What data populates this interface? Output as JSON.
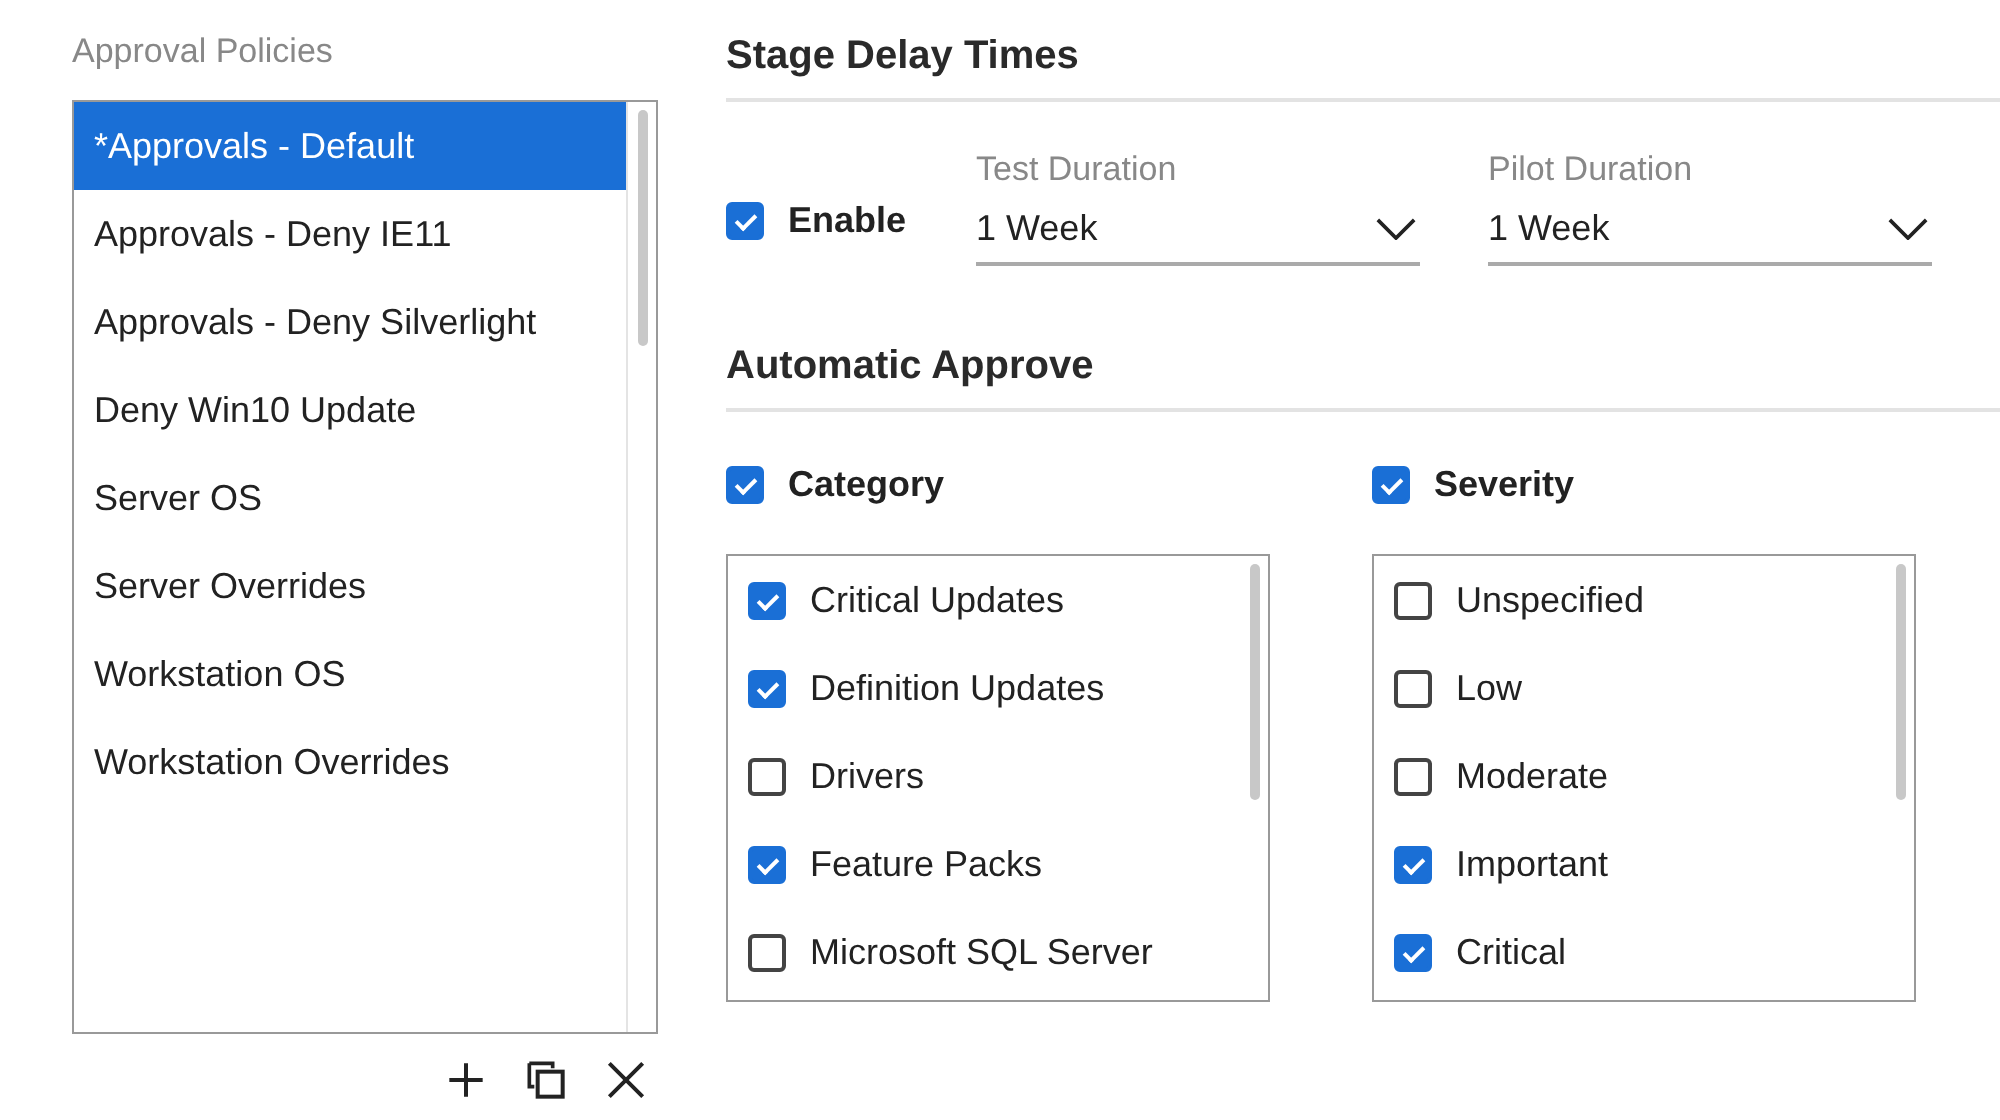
{
  "policies": {
    "title": "Approval Policies",
    "items": [
      {
        "label": "*Approvals - Default",
        "selected": true
      },
      {
        "label": "Approvals - Deny IE11",
        "selected": false
      },
      {
        "label": "Approvals - Deny Silverlight",
        "selected": false
      },
      {
        "label": "Deny Win10 Update",
        "selected": false
      },
      {
        "label": "Server OS",
        "selected": false
      },
      {
        "label": "Server Overrides",
        "selected": false
      },
      {
        "label": "Workstation OS",
        "selected": false
      },
      {
        "label": "Workstation Overrides",
        "selected": false
      }
    ]
  },
  "stage_delay": {
    "title": "Stage Delay Times",
    "enable": {
      "label": "Enable",
      "checked": true
    },
    "dropdowns": [
      {
        "label": "Test Duration",
        "value": "1 Week"
      },
      {
        "label": "Pilot Duration",
        "value": "1 Week"
      }
    ]
  },
  "automatic_approve": {
    "title": "Automatic Approve",
    "groups": [
      {
        "label": "Category",
        "checked": true,
        "items": [
          {
            "label": "Critical Updates",
            "checked": true
          },
          {
            "label": "Definition Updates",
            "checked": true
          },
          {
            "label": "Drivers",
            "checked": false
          },
          {
            "label": "Feature Packs",
            "checked": true
          },
          {
            "label": "Microsoft SQL Server",
            "checked": false
          }
        ]
      },
      {
        "label": "Severity",
        "checked": true,
        "items": [
          {
            "label": "Unspecified",
            "checked": false
          },
          {
            "label": "Low",
            "checked": false
          },
          {
            "label": "Moderate",
            "checked": false
          },
          {
            "label": "Important",
            "checked": true
          },
          {
            "label": "Critical",
            "checked": true
          }
        ]
      }
    ]
  }
}
